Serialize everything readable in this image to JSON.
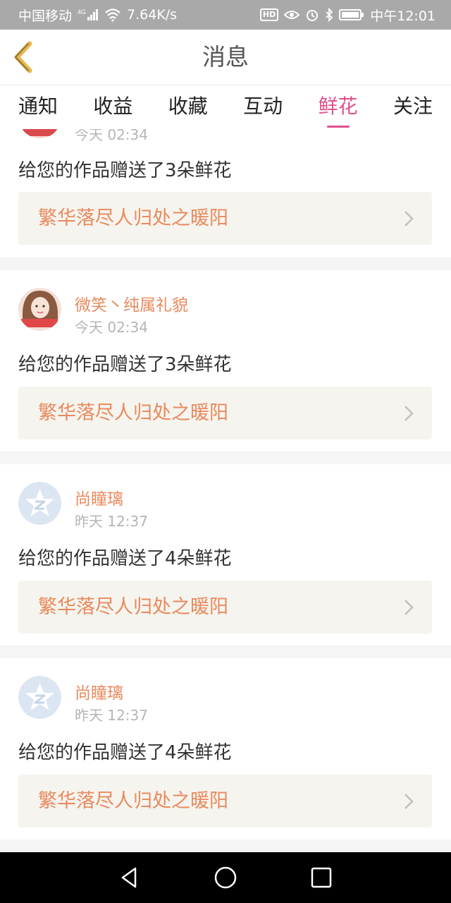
{
  "status_bar": {
    "carrier": "中国移动",
    "network": "4G",
    "speed": "7.64K/s",
    "hd_label": "HD",
    "time": "中午12:01"
  },
  "header": {
    "title": "消息"
  },
  "tabs": [
    {
      "label": "通知",
      "active": false
    },
    {
      "label": "收益",
      "active": false
    },
    {
      "label": "收藏",
      "active": false
    },
    {
      "label": "互动",
      "active": false
    },
    {
      "label": "鲜花",
      "active": true
    },
    {
      "label": "关注",
      "active": false
    }
  ],
  "notifications": [
    {
      "username": "",
      "time": "今天 02:34",
      "message": "给您的作品赠送了3朵鲜花",
      "work_title": "繁华落尽人归处之暖阳",
      "avatar": "girl-photo"
    },
    {
      "username": "微笑丶纯属礼貌",
      "time": "今天 02:34",
      "message": "给您的作品赠送了3朵鲜花",
      "work_title": "繁华落尽人归处之暖阳",
      "avatar": "girl-photo"
    },
    {
      "username": "尚瞳璃",
      "time": "昨天 12:37",
      "message": "给您的作品赠送了4朵鲜花",
      "work_title": "繁华落尽人归处之暖阳",
      "avatar": "default-star"
    },
    {
      "username": "尚瞳璃",
      "time": "昨天 12:37",
      "message": "给您的作品赠送了4朵鲜花",
      "work_title": "繁华落尽人归处之暖阳",
      "avatar": "default-star"
    }
  ],
  "colors": {
    "accent": "#e14e8d",
    "name": "#e98a5e",
    "link_bg": "#f5f4ee"
  }
}
